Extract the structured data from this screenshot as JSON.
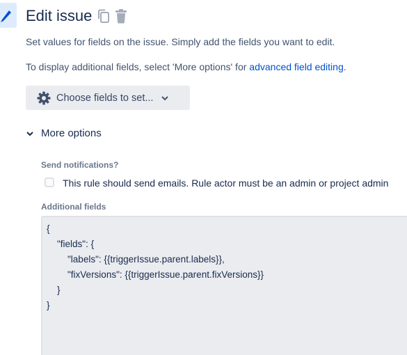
{
  "header": {
    "title": "Edit issue",
    "icons": [
      "pencil-icon",
      "copy-icon",
      "trash-icon"
    ]
  },
  "description": {
    "line1": "Set values for fields on the issue. Simply add the fields you want to edit.",
    "line2_prefix": "To display additional fields, select 'More options' for ",
    "line2_link": "advanced field editing",
    "line2_suffix": "."
  },
  "choose_fields": {
    "label": "Choose fields to set...",
    "icon": "gear-icon",
    "chevron": "chevron-down-icon"
  },
  "more_options": {
    "label": "More options",
    "expanded": true
  },
  "send_notifications": {
    "label": "Send notifications?",
    "checkbox_text": "This rule should send emails. Rule actor must be an admin or project admin",
    "checked": false
  },
  "additional_fields": {
    "label": "Additional fields",
    "lines": [
      "{",
      "    \"fields\": {",
      "        \"labels\": {{triggerIssue.parent.labels}},",
      "        \"fixVersions\": {{triggerIssue.parent.fixVersions}}",
      "    }",
      "}"
    ]
  },
  "colors": {
    "text": "#172B4D",
    "subtle": "#42526E",
    "link": "#0052CC",
    "selected_bg": "#DEEBFF",
    "button_bg": "#EBECF0"
  }
}
